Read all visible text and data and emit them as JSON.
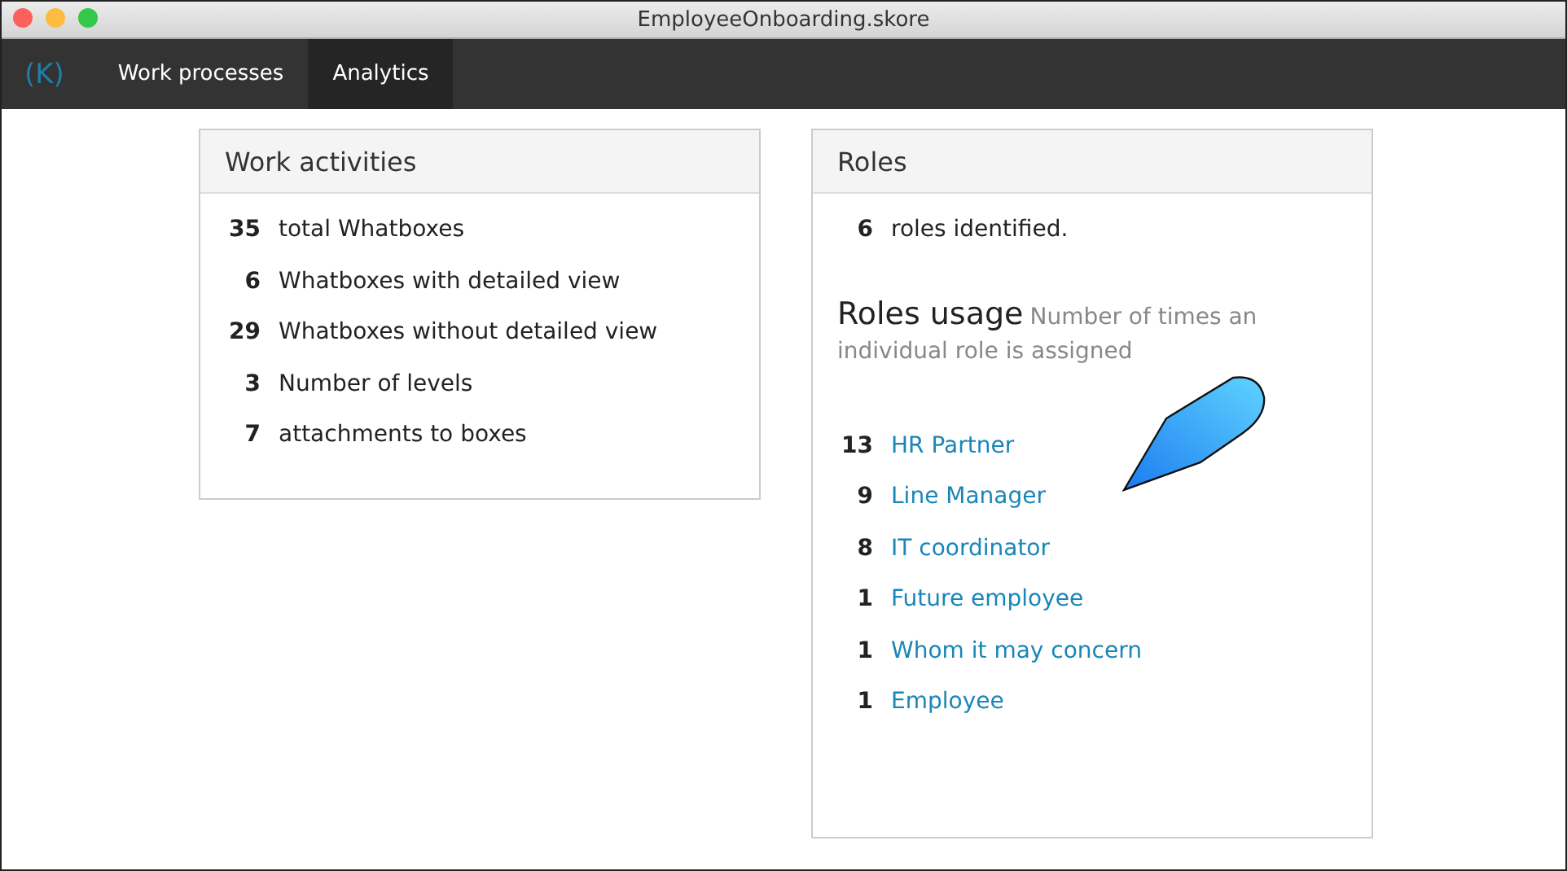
{
  "window": {
    "title": "EmployeeOnboarding.skore"
  },
  "nav": {
    "logo": "(K)",
    "tabs": [
      {
        "label": "Work processes",
        "selected": false
      },
      {
        "label": "Analytics",
        "selected": true
      }
    ]
  },
  "work_activities": {
    "title": "Work activities",
    "stats": [
      {
        "count": "35",
        "label": "total Whatboxes"
      },
      {
        "count": "6",
        "label": "Whatboxes with detailed view"
      },
      {
        "count": "29",
        "label": "Whatboxes without detailed view"
      },
      {
        "count": "3",
        "label": "Number of levels"
      },
      {
        "count": "7",
        "label": "attachments to boxes"
      }
    ]
  },
  "roles": {
    "title": "Roles",
    "summary": {
      "count": "6",
      "label": "roles identified."
    },
    "usage_title": "Roles usage",
    "usage_subtitle": "Number of times an individual role is assigned",
    "usage": [
      {
        "count": "13",
        "role": "HR Partner"
      },
      {
        "count": "9",
        "role": "Line Manager"
      },
      {
        "count": "8",
        "role": "IT coordinator"
      },
      {
        "count": "1",
        "role": "Future employee"
      },
      {
        "count": "1",
        "role": "Whom it may concern"
      },
      {
        "count": "1",
        "role": "Employee"
      }
    ]
  }
}
